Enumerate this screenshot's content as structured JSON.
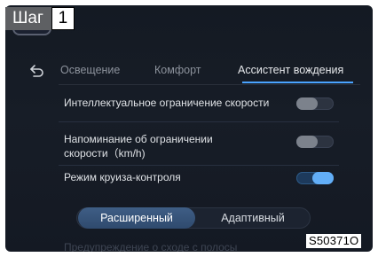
{
  "step_badge": {
    "word": "Шаг",
    "number": "1"
  },
  "header": {
    "back_icon": "back-arrow-icon",
    "tabs": [
      {
        "label": "Освещение",
        "active": false
      },
      {
        "label": "Комфорт",
        "active": false
      },
      {
        "label": "Ассистент вождения",
        "active": true
      }
    ],
    "accent_color": "#4aa3ff"
  },
  "settings": [
    {
      "label": "Интеллектуальное ограничение скорости",
      "toggle": "off"
    },
    {
      "label_line1": "Напоминание об ограничении",
      "label_line2": "скорости（km/h)",
      "toggle": "off"
    },
    {
      "label": "Режим круиза-контроля",
      "toggle": "on"
    }
  ],
  "cruise_mode": {
    "options": [
      "Расширенный",
      "Адаптивный"
    ],
    "selected": "Расширенный"
  },
  "next_item_partial": "Предупреждение о сходе с полосы",
  "image_code": "S50371O"
}
